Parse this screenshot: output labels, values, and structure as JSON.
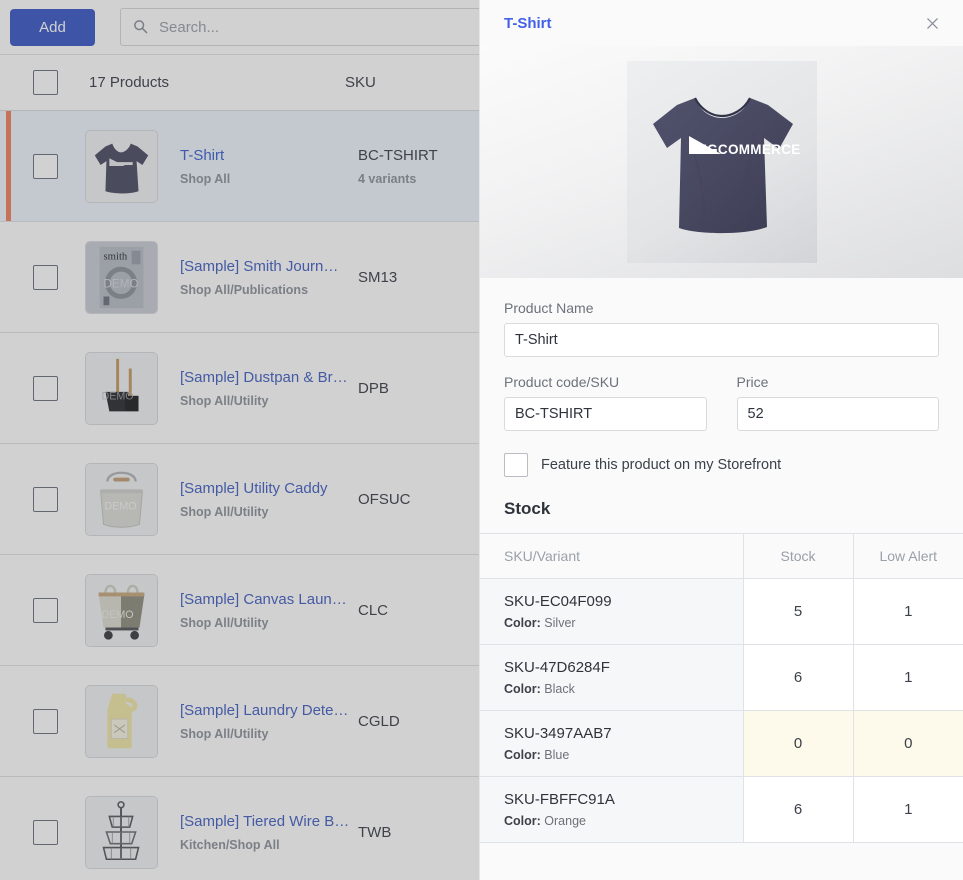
{
  "toolbar": {
    "add_label": "Add",
    "search_placeholder": "Search...",
    "search_value": "",
    "search_icon": "search-icon"
  },
  "list": {
    "header": {
      "count_label": "17 Products",
      "sku_label": "SKU"
    },
    "rows": [
      {
        "name": "T-Shirt",
        "category": "Shop All",
        "sku": "BC-TSHIRT",
        "sub": "4 variants",
        "selected": true,
        "thumb": "tshirt-thumb"
      },
      {
        "name": "[Sample] Smith Journ…",
        "category": "Shop All/Publications",
        "sku": "SM13",
        "sub": "",
        "selected": false,
        "thumb": "journal-thumb"
      },
      {
        "name": "[Sample] Dustpan & Br…",
        "category": "Shop All/Utility",
        "sku": "DPB",
        "sub": "",
        "selected": false,
        "thumb": "dustpan-thumb"
      },
      {
        "name": "[Sample] Utility Caddy",
        "category": "Shop All/Utility",
        "sku": "OFSUC",
        "sub": "",
        "selected": false,
        "thumb": "caddy-thumb"
      },
      {
        "name": "[Sample] Canvas Laun…",
        "category": "Shop All/Utility",
        "sku": "CLC",
        "sub": "",
        "selected": false,
        "thumb": "laundry-cart-thumb"
      },
      {
        "name": "[Sample] Laundry Dete…",
        "category": "Shop All/Utility",
        "sku": "CGLD",
        "sub": "",
        "selected": false,
        "thumb": "detergent-thumb"
      },
      {
        "name": "[Sample] Tiered Wire B…",
        "category": "Kitchen/Shop All",
        "sku": "TWB",
        "sub": "",
        "selected": false,
        "thumb": "wire-basket-thumb"
      }
    ]
  },
  "panel": {
    "title": "T-Shirt",
    "close_icon": "close-icon",
    "hero_image_alt": "tshirt-hero-image",
    "hero_logo_text": "BIGCOMMERCE",
    "form": {
      "product_name_label": "Product Name",
      "product_name_value": "T-Shirt",
      "sku_label": "Product code/SKU",
      "sku_value": "BC-TSHIRT",
      "price_label": "Price",
      "price_value": "52",
      "feature_checkbox_label": "Feature this product on my Storefront",
      "feature_checked": false
    },
    "stock": {
      "section_title": "Stock",
      "columns": [
        "SKU/Variant",
        "Stock",
        "Low Alert"
      ],
      "rows": [
        {
          "sku": "SKU-EC04F099",
          "variant_key": "Color:",
          "variant_value": "Silver",
          "stock": "5",
          "low_alert": "1",
          "low": false
        },
        {
          "sku": "SKU-47D6284F",
          "variant_key": "Color:",
          "variant_value": "Black",
          "stock": "6",
          "low_alert": "1",
          "low": false
        },
        {
          "sku": "SKU-3497AAB7",
          "variant_key": "Color:",
          "variant_value": "Blue",
          "stock": "0",
          "low_alert": "0",
          "low": true
        },
        {
          "sku": "SKU-FBFFC91A",
          "variant_key": "Color:",
          "variant_value": "Orange",
          "stock": "6",
          "low_alert": "1",
          "low": false
        }
      ]
    }
  },
  "colors": {
    "accent_blue": "#3b5ac7",
    "link_blue": "#4361c4",
    "selected_row": "#eef5fd",
    "row_accent_orange": "#f1805e",
    "low_alert_bg": "#fdfaeb"
  }
}
